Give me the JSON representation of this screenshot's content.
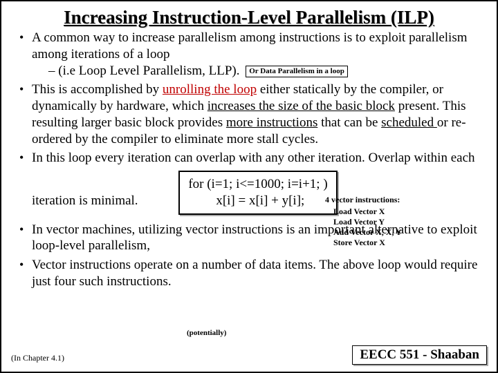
{
  "title": "Increasing Instruction-Level Parallelism (ILP)",
  "bullets": {
    "b1_a": "A common way to increase parallelism among instructions is to exploit parallelism among iterations of a loop",
    "b1_sub_a": "–  (i.e  Loop Level Parallelism, LLP).",
    "b1_note": "Or Data Parallelism in a loop",
    "b2_a": "This is accomplished by ",
    "b2_unroll": "unrolling the loop",
    "b2_b": " either statically by the compiler, or dynamically by hardware, which ",
    "b2_u1": "increases the size of the basic block",
    "b2_c": " present.  This resulting larger basic block provides ",
    "b2_u2": "more instructions",
    "b2_d": " that can be ",
    "b2_u3": "scheduled ",
    "b2_e": "or re-ordered by the compiler to eliminate more stall cycles.",
    "b3": "In this loop every iteration can overlap with any other iteration. Overlap within each iteration is minimal.",
    "b4": "In vector machines, utilizing vector instructions is an important alternative to exploit loop-level parallelism,",
    "b5": "Vector instructions operate on a number of data items.  The above loop would require just  four such instructions."
  },
  "code": {
    "line1": "for (i=1; i<=1000; i=i+1; )",
    "line2": "x[i] = x[i] + y[i];"
  },
  "vector": {
    "header": "4 vector instructions:",
    "i1": "Load Vector X",
    "i2": "Load Vector Y",
    "i3": "Add Vector X, X, Y",
    "i4": "Store Vector X"
  },
  "potentially": "(potentially)",
  "footer_left": "(In  Chapter 4.1)",
  "footer_right": "EECC 551 - Shaaban"
}
